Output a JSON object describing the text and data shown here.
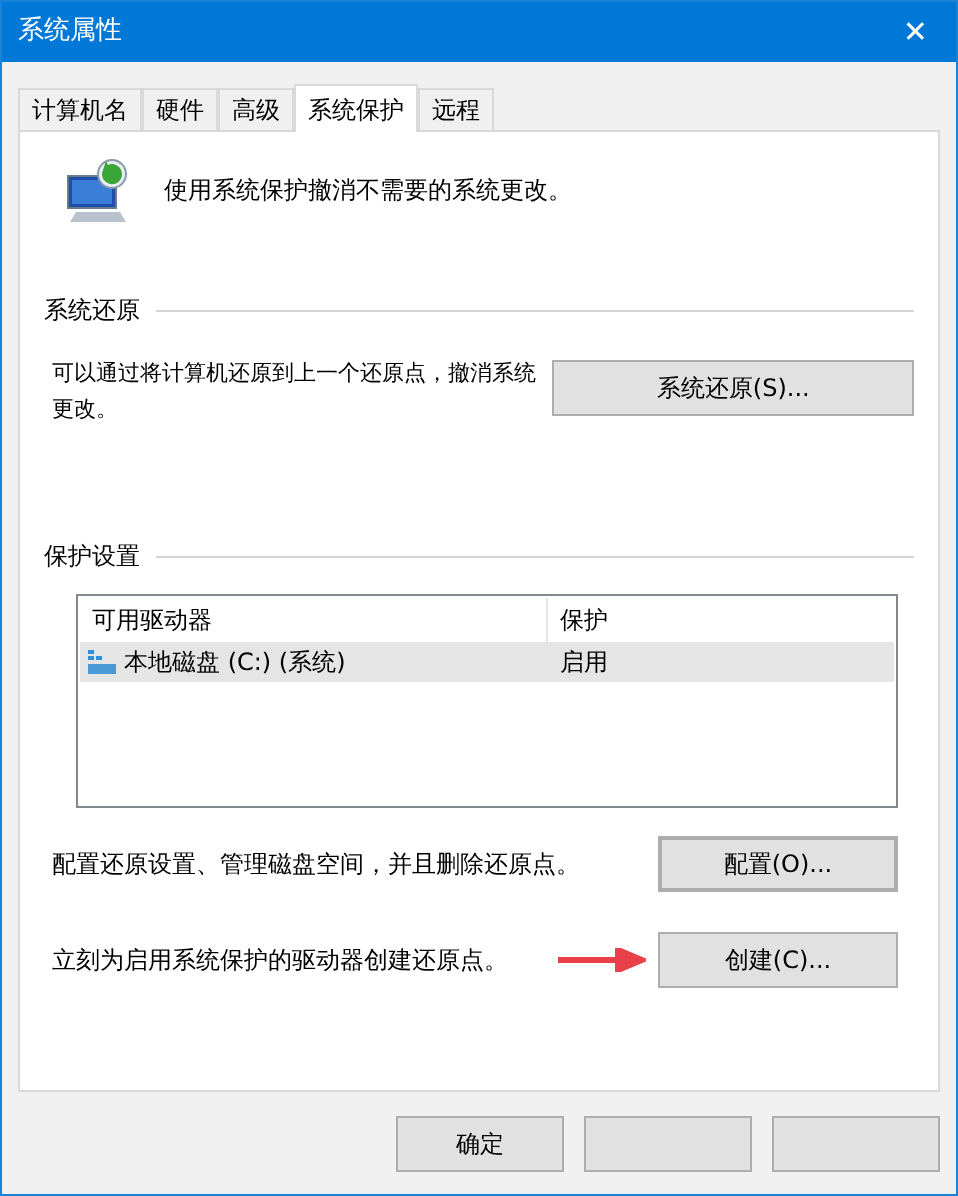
{
  "window": {
    "title": "系统属性",
    "close": "✕"
  },
  "tabs": [
    {
      "label": "计算机名",
      "selected": false
    },
    {
      "label": "硬件",
      "selected": false
    },
    {
      "label": "高级",
      "selected": false
    },
    {
      "label": "系统保护",
      "selected": true
    },
    {
      "label": "远程",
      "selected": false
    }
  ],
  "intro": "使用系统保护撤消不需要的系统更改。",
  "restore": {
    "heading": "系统还原",
    "text": "可以通过将计算机还原到上一个还原点，撤消系统更改。",
    "button": "系统还原(S)..."
  },
  "protection": {
    "heading": "保护设置",
    "columns": [
      "可用驱动器",
      "保护"
    ],
    "rows": [
      {
        "drive": "本地磁盘 (C:) (系统)",
        "protection": "启用",
        "selected": true
      }
    ],
    "configure_text": "配置还原设置、管理磁盘空间，并且删除还原点。",
    "configure_button": "配置(O)...",
    "create_text": "立刻为启用系统保护的驱动器创建还原点。",
    "create_button": "创建(C)..."
  },
  "buttons": [
    {
      "kind": "labelled",
      "label": "确定"
    },
    {
      "kind": "covered"
    },
    {
      "kind": "covered"
    }
  ]
}
